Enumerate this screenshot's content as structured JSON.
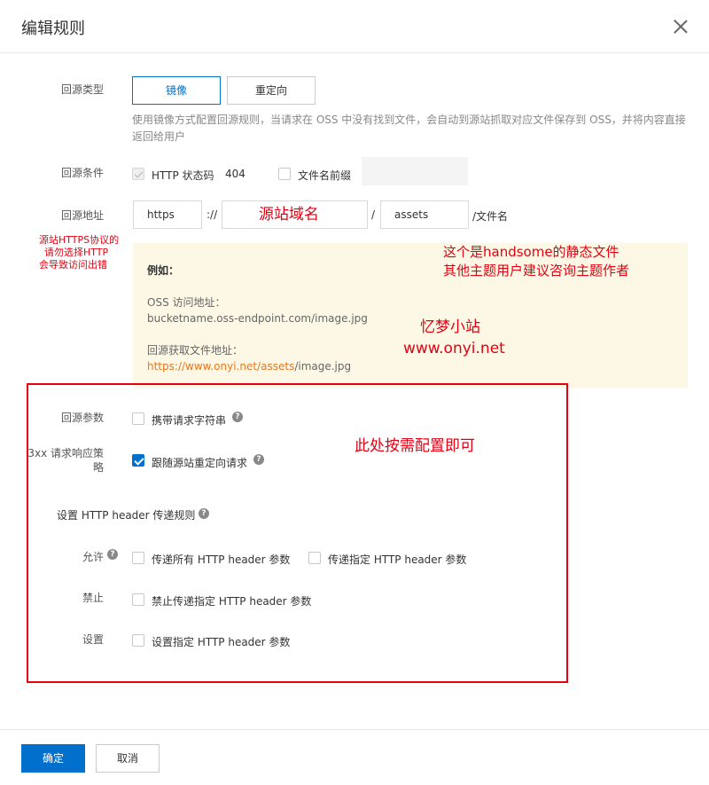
{
  "dialog": {
    "title": "编辑规则"
  },
  "form": {
    "source_type": {
      "label": "回源类型",
      "options": [
        "镜像",
        "重定向"
      ],
      "hint_line1": "使用镜像方式配置回源规则，当请求在 OSS 中没有找到文件，会自动到源站抓取对应文件保存到 OSS，并将内容直接",
      "hint_line2": "返回给用户"
    },
    "condition": {
      "label": "回源条件",
      "http_status_label": "HTTP 状态码",
      "http_status_value": "404",
      "prefix_label": "文件名前缀",
      "prefix_value": ""
    },
    "address": {
      "label": "回源地址",
      "protocol": "https",
      "sep1": "://",
      "domain_placeholder": "源站域名",
      "sep2": "/",
      "path": "assets",
      "suffix": "/文件名"
    },
    "example": {
      "heading": "例如：",
      "oss_label": "OSS 访问地址：",
      "oss_value": "bucketname.oss-endpoint.com/image.jpg",
      "origin_label": "回源获取文件地址：",
      "origin_part1": "https://www.onyi.net/",
      "origin_part2": "assets",
      "origin_part3": "/image.jpg"
    },
    "params": {
      "label": "回源参数",
      "option": "携带请求字符串"
    },
    "redirect": {
      "label_line1": "3xx 请求响应策",
      "label_line2": "略",
      "option": "跟随源站重定向请求"
    },
    "http_header": {
      "title": "设置 HTTP header 传递规则",
      "allow_label": "允许",
      "allow_opt1": "传递所有 HTTP header 参数",
      "allow_opt2": "传递指定 HTTP header 参数",
      "deny_label": "禁止",
      "deny_opt": "禁止传递指定 HTTP header 参数",
      "set_label": "设置",
      "set_opt": "设置指定 HTTP header 参数"
    }
  },
  "annotations": {
    "https_note_1": "源站HTTPS协议的",
    "https_note_2": "请勿选择HTTP",
    "https_note_3": "会导致访问出错",
    "handsome_1": "这个是handsome的静态文件",
    "handsome_2": "其他主题用户建议咨询主题作者",
    "site_name": "忆梦小站",
    "site_url": "www.onyi.net",
    "config_note": "此处按需配置即可"
  },
  "footer": {
    "ok": "确定",
    "cancel": "取消"
  },
  "colors": {
    "primary": "#0070cc",
    "annotation": "#e60012",
    "example_bg": "#fcf8e5",
    "link_orange": "#e87722"
  }
}
